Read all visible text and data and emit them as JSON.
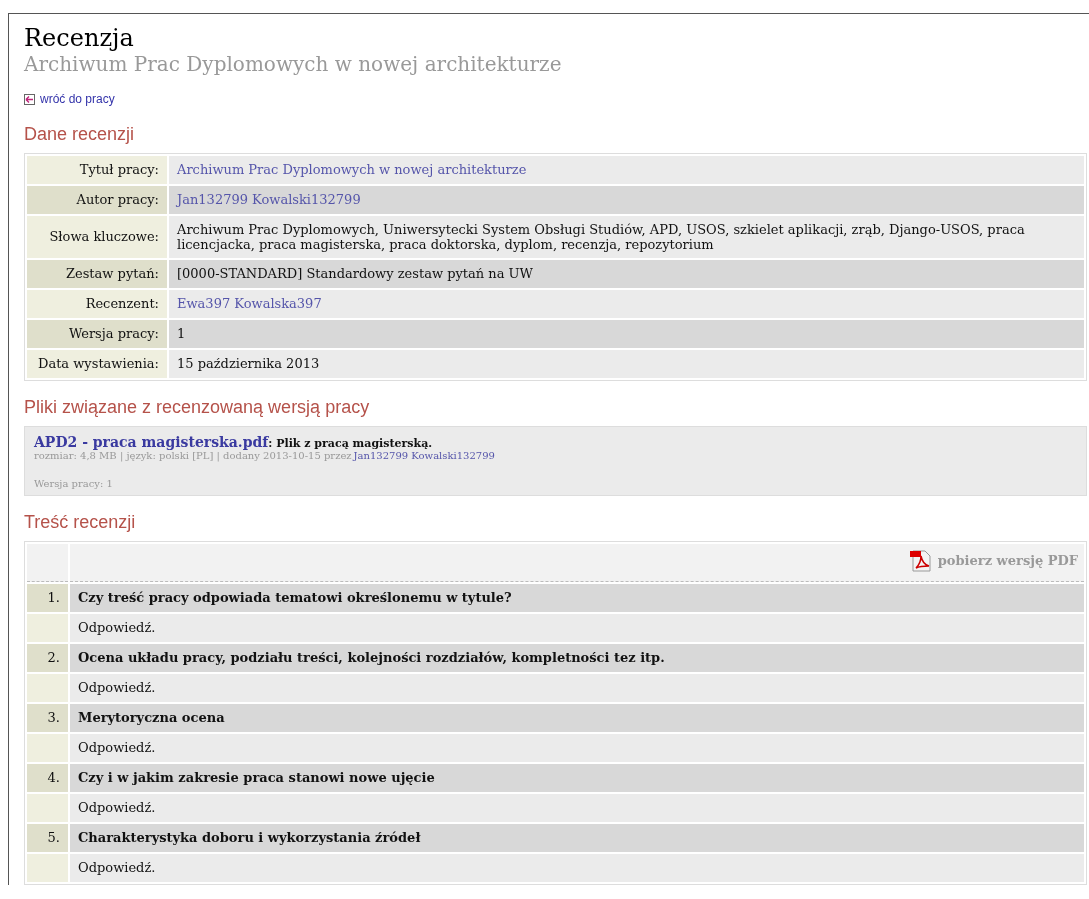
{
  "title": "Recenzja",
  "subtitle": "Archiwum Prac Dyplomowych w nowej architekturze",
  "back_link": "wróć do pracy",
  "details": {
    "heading": "Dane recenzji",
    "rows": [
      {
        "label": "Tytuł pracy:",
        "value": "Archiwum Prac Dyplomowych w nowej architekturze",
        "kind": "link"
      },
      {
        "label": "Autor pracy:",
        "value": "Jan132799 Kowalski132799",
        "kind": "link"
      },
      {
        "label": "Słowa kluczowe:",
        "value": "Archiwum Prac Dyplomowych, Uniwersytecki System Obsługi Studiów, APD, USOS, szkielet aplikacji, zrąb, Django-USOS, praca licencjacka, praca magisterska, praca doktorska, dyplom, recenzja, repozytorium",
        "kind": "text"
      },
      {
        "label": "Zestaw pytań:",
        "value": "[0000-STANDARD] Standardowy zestaw pytań na UW",
        "kind": "text"
      },
      {
        "label": "Recenzent:",
        "value": "Ewa397 Kowalska397",
        "kind": "link"
      },
      {
        "label": "Wersja pracy:",
        "value": "1",
        "kind": "text"
      },
      {
        "label": "Data wystawienia:",
        "value": "15 października 2013",
        "kind": "text"
      }
    ]
  },
  "files": {
    "heading": "Pliki związane z recenzowaną wersją pracy",
    "items": [
      {
        "name": "APD2 - praca magisterska.pdf",
        "description": ": Plik z pracą magisterską.",
        "meta": "rozmiar: 4,8 MB | język: polski [PL] | dodany 2013-10-15 przez",
        "author": "Jan132799 Kowalski132799",
        "version": "Wersja pracy: 1"
      }
    ]
  },
  "review": {
    "heading": "Treść recenzji",
    "pdf_link": "pobierz wersję PDF",
    "questions": [
      {
        "number": "1.",
        "question": "Czy treść pracy odpowiada tematowi określonemu w tytule?",
        "answer": "Odpowiedź."
      },
      {
        "number": "2.",
        "question": "Ocena układu pracy, podziału treści, kolejności rozdziałów, kompletności tez itp.",
        "answer": "Odpowiedź."
      },
      {
        "number": "3.",
        "question": "Merytoryczna ocena",
        "answer": "Odpowiedź."
      },
      {
        "number": "4.",
        "question": "Czy i w jakim zakresie praca stanowi nowe ujęcie",
        "answer": "Odpowiedź."
      },
      {
        "number": "5.",
        "question": "Charakterystyka doboru i wykorzystania źródeł",
        "answer": "Odpowiedź."
      }
    ]
  }
}
